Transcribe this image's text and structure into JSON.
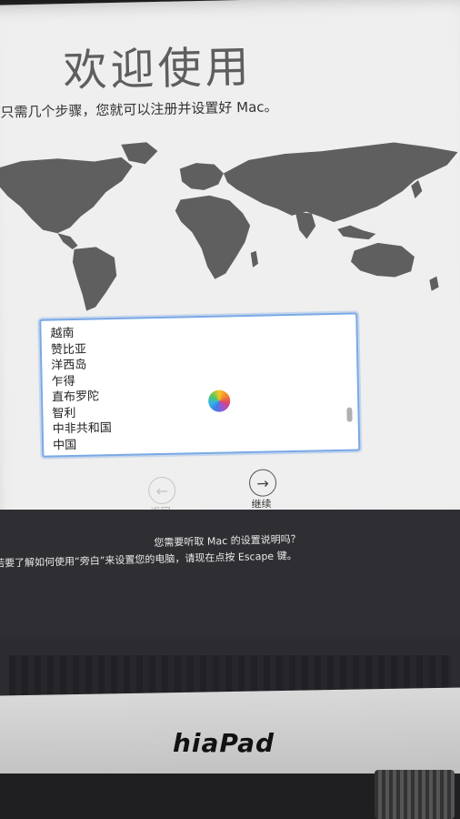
{
  "setup": {
    "title": "欢迎使用",
    "subtitle": "只需几个步骤，您就可以注册并设置好 Mac。"
  },
  "countries": [
    "越南",
    "赞比亚",
    "洋西岛",
    "乍得",
    "直布罗陀",
    "智利",
    "中非共和国",
    "中国"
  ],
  "nav": {
    "back_label": "返回",
    "continue_label": "继续"
  },
  "voiceover": {
    "line1": "您需要听取 Mac 的设置说明吗？",
    "line2": "若要了解如何使用“旁白”来设置您的电脑，请现在点按 Escape 键。"
  },
  "brand": {
    "name": "hiaPad"
  },
  "colors": {
    "list_focus_ring": "#7aa9e6",
    "map_land": "#5f5f5f"
  }
}
